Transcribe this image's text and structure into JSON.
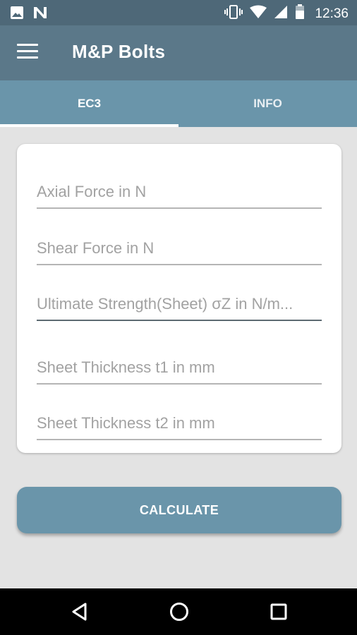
{
  "status_bar": {
    "time": "12:36",
    "icons": [
      "image-icon",
      "n-notification-icon",
      "vibrate-icon",
      "wifi-icon",
      "signal-icon",
      "battery-icon"
    ]
  },
  "app_bar": {
    "title": "M&P Bolts",
    "menu_icon": "hamburger-menu-icon"
  },
  "tabs": [
    {
      "label": "EC3",
      "active": true
    },
    {
      "label": "INFO",
      "active": false
    }
  ],
  "form": {
    "fields": [
      {
        "placeholder": "Axial Force in N",
        "value": ""
      },
      {
        "placeholder": "Shear Force in N",
        "value": ""
      },
      {
        "placeholder": "Ultimate Strength(Sheet) σZ in N/m...",
        "value": ""
      },
      {
        "placeholder": "Sheet Thickness t1 in mm",
        "value": ""
      },
      {
        "placeholder": "Sheet Thickness t2 in mm",
        "value": ""
      }
    ]
  },
  "calculate_label": "CALCULATE",
  "nav_bar": {
    "icons": [
      "back-icon",
      "home-icon",
      "recents-icon"
    ]
  },
  "colors": {
    "status_bar": "#4e6878",
    "app_bar": "#5b7889",
    "accent": "#6a95aa",
    "background": "#e3e3e3"
  }
}
